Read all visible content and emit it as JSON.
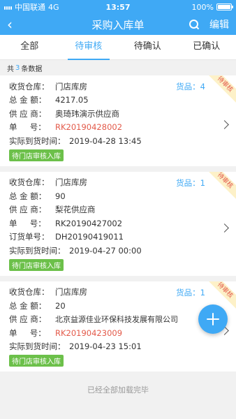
{
  "status_bar": {
    "carrier": "中国联通",
    "network": "4G",
    "time": "13:57",
    "battery": "100%",
    "battery_level": 1.0
  },
  "header": {
    "back_icon": "chevron-left-icon",
    "title": "采购入库单",
    "search_icon": "search-icon",
    "edit_label": "编辑"
  },
  "tabs": [
    {
      "label": "全部",
      "active": false
    },
    {
      "label": "待审核",
      "active": true
    },
    {
      "label": "待确认",
      "active": false
    },
    {
      "label": "已确认",
      "active": false
    }
  ],
  "summary": {
    "prefix": "共",
    "count": "3",
    "suffix": "条数据"
  },
  "labels": {
    "warehouse": "收货仓库：",
    "amount": "总 金 额：",
    "supplier": "供 应 商：",
    "doc_no": "单     号：",
    "order_no": "订货单号：",
    "arrival": "实际到货时间："
  },
  "cards": [
    {
      "warehouse": "门店库房",
      "goods": "货品：4",
      "ribbon": "待审核",
      "amount": "4217.05",
      "supplier": "奥琦玮演示供应商",
      "doc_no": "RK20190428002",
      "doc_no_highlight": true,
      "arrival": "2019-04-28 13:45",
      "status": "待门店审核入库"
    },
    {
      "warehouse": "门店库房",
      "goods": "货品：1",
      "ribbon": "待审核",
      "amount": "90",
      "supplier": "梨花供应商",
      "doc_no": "RK20190427002",
      "doc_no_highlight": false,
      "order_no": "DH20190419011",
      "arrival": "2019-04-27 00:00",
      "status": "待门店审核入库"
    },
    {
      "warehouse": "门店库房",
      "goods": "货品：1",
      "ribbon": "待审核",
      "amount": "20",
      "supplier": "北京益源佳业环保科技发展有限公司",
      "doc_no": "RK20190423009",
      "doc_no_highlight": true,
      "arrival": "2019-04-23 15:01",
      "status": "待门店审核入库"
    }
  ],
  "footer_text": "已经全部加载完毕",
  "fab_icon": "plus-icon",
  "colors": {
    "primary": "#3fa9f5",
    "code": "#e35a4a",
    "badge": "#6cc04a",
    "ribbon_bg": "#fdf1c8"
  }
}
